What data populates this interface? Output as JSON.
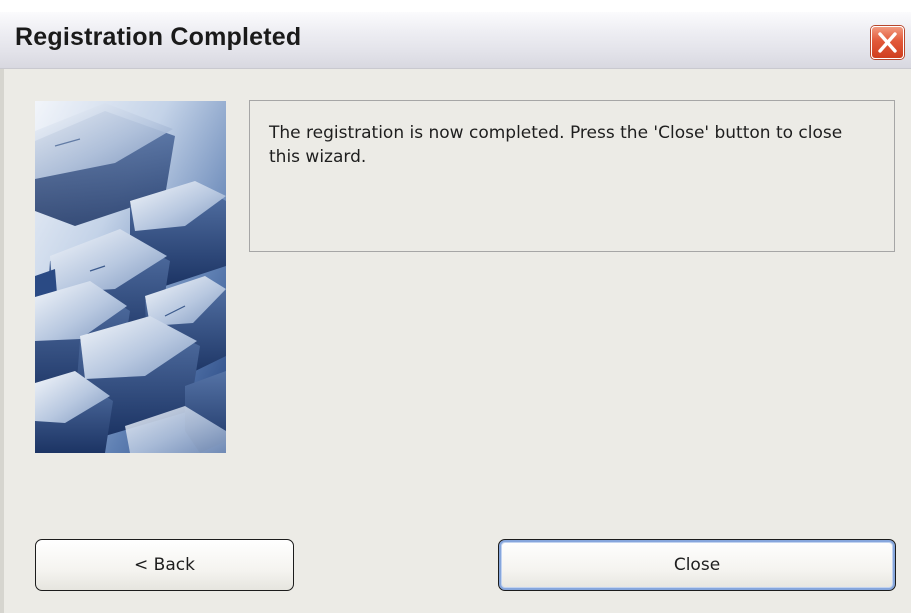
{
  "window": {
    "title": "Registration Completed"
  },
  "titlebar": {
    "close_icon": "close-icon"
  },
  "hero": {
    "image": "keyboard-keys-image"
  },
  "message": {
    "text": "The registration is now completed. Press the 'Close' button to close this wizard."
  },
  "buttons": {
    "back_label": "< Back",
    "close_label": "Close"
  },
  "colors": {
    "titlebar_bg": "#e6e6ec",
    "close_button": "#d9482a",
    "window_bg": "#ecebe6",
    "default_button_focus": "#86a6dc"
  }
}
